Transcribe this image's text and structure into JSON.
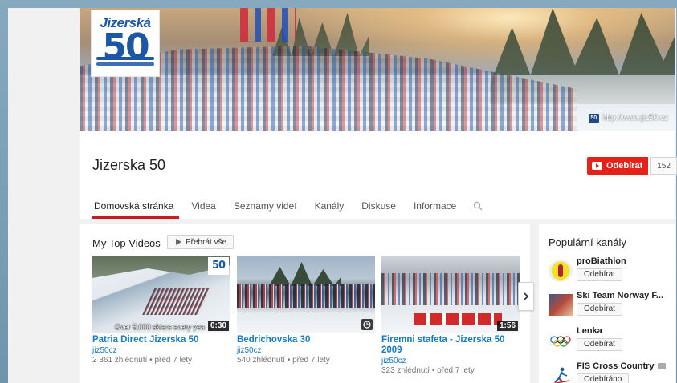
{
  "banner": {
    "logo_top": "Jizerská",
    "logo_num": "50",
    "link_text": "http://www.jiz50.cz"
  },
  "channel": {
    "name": "Jizerska 50",
    "subscribe_label": "Odebírat",
    "subscriber_count": "152"
  },
  "tabs": [
    {
      "label": "Domovská stránka",
      "active": true
    },
    {
      "label": "Videa"
    },
    {
      "label": "Seznamy videí"
    },
    {
      "label": "Kanály"
    },
    {
      "label": "Diskuse"
    },
    {
      "label": "Informace"
    }
  ],
  "section": {
    "title": "My Top Videos",
    "play_all_label": "Přehrát vše"
  },
  "videos": [
    {
      "title": "Patria Direct Jizerska 50",
      "channel": "jiz50cz",
      "meta": "2 361 zhlédnutí • před 7 lety",
      "duration": "0:30",
      "overlay_caption": "Over 5,000 skiers every yea",
      "thumb_logo": "50"
    },
    {
      "title": "Bedrichovska 30",
      "channel": "jiz50cz",
      "meta": "540 zhlédnutí • před 7 lety",
      "overlay_icon": "clock-icon"
    },
    {
      "title": "Firemni stafeta - Jizerska 50 2009",
      "channel": "jiz50cz",
      "meta": "323 zhlédnutí • před 7 lety",
      "duration": "1:56"
    }
  ],
  "sidebar": {
    "title": "Populární kanály",
    "channels": [
      {
        "name": "proBiathlon",
        "button": "Odebírat",
        "avatar": "biathlon-avatar"
      },
      {
        "name": "Ski Team Norway F...",
        "button": "Odebírat",
        "avatar": "norway-avatar"
      },
      {
        "name": "Lenka",
        "button": "Odebírat",
        "avatar": "olympic-rings-avatar"
      },
      {
        "name": "FIS Cross Country",
        "button": "Odebíráno",
        "avatar": "fis-avatar",
        "verified": true
      }
    ]
  },
  "colors": {
    "accent_red": "#e62117",
    "link_blue": "#167ac6",
    "tab_underline": "#cc181e",
    "logo_blue": "#1c57a5"
  }
}
